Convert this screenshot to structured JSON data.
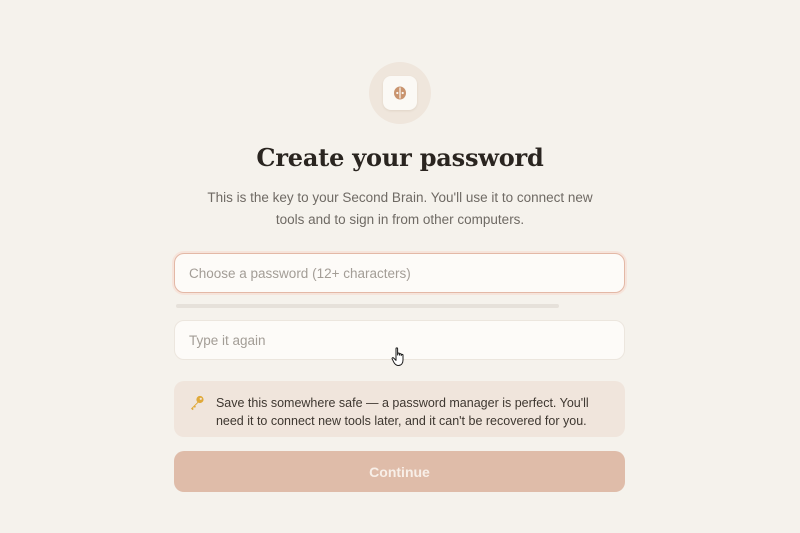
{
  "header": {
    "title": "Create your password",
    "subtitle": "This is the key to your Second Brain. You'll use it to connect new tools and to sign in from other computers.",
    "logo_icon": "brain-logo-icon"
  },
  "form": {
    "password": {
      "value": "",
      "placeholder": "Choose a password (12+ characters)"
    },
    "strength": {
      "fill": 0.0
    },
    "confirm": {
      "value": "",
      "placeholder": "Type it again"
    }
  },
  "notice": {
    "icon": "key-icon",
    "text": "Save this somewhere safe — a password manager is perfect. You'll need it to connect new tools later, and it can't be recovered for you."
  },
  "actions": {
    "continue_label": "Continue"
  },
  "colors": {
    "background": "#f5f2ec",
    "accent": "#dfbca9",
    "focus_border": "#e3b8a6",
    "notice_bg": "#f0e5dc"
  }
}
